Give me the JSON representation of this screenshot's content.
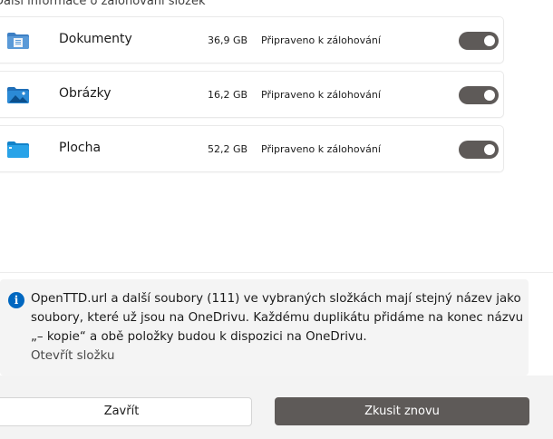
{
  "header": {
    "link_text": "Další informace o zálohování složek"
  },
  "folders": [
    {
      "name": "Dokumenty",
      "size": "36,9 GB",
      "status": "Připraveno k zálohování",
      "icon": "documents-folder-icon",
      "enabled": true
    },
    {
      "name": "Obrázky",
      "size": "16,2 GB",
      "status": "Připraveno k zálohování",
      "icon": "pictures-folder-icon",
      "enabled": true
    },
    {
      "name": "Plocha",
      "size": "52,2 GB",
      "status": "Připraveno k zálohování",
      "icon": "desktop-folder-icon",
      "enabled": true
    }
  ],
  "info": {
    "icon": "info-icon",
    "message": "OpenTTD.url a další soubory (111) ve vybraných složkách mají stejný název jako soubory, které už jsou na OneDrivu. Každému duplikátu přidáme na konec názvu „– kopie“ a obě položky budou k dispozici na OneDrivu.",
    "link_text": "Otevřít složku"
  },
  "footer": {
    "close_label": "Zavřít",
    "retry_label": "Zkusit znovu"
  },
  "colors": {
    "accent": "#0067c0",
    "toggle_on": "#5e5a58",
    "primary_button": "#5e5a58"
  }
}
